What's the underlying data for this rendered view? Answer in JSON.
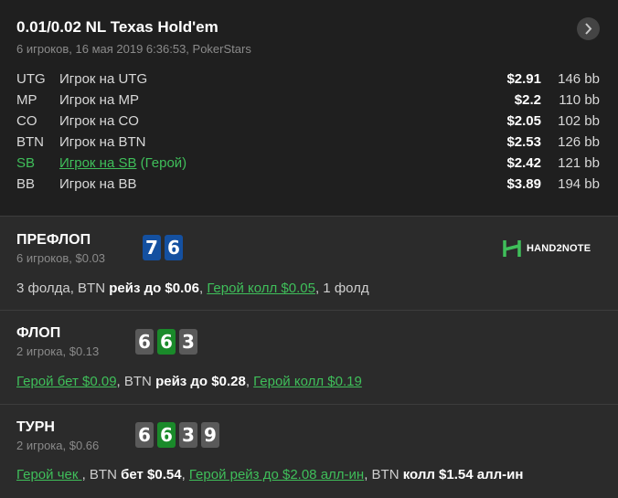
{
  "header": {
    "title": "0.01/0.02 NL Texas Hold'em",
    "subtitle": "6 игроков, 16 мая 2019 6:36:53, PokerStars",
    "next_icon": "chevron-right-icon"
  },
  "players": [
    {
      "pos": "UTG",
      "name": "Игрок на UTG",
      "hero_tag": "",
      "stack": "$2.91",
      "bb": "146 bb"
    },
    {
      "pos": "MP",
      "name": "Игрок на MP",
      "hero_tag": "",
      "stack": "$2.2",
      "bb": "110 bb"
    },
    {
      "pos": "CO",
      "name": "Игрок на CO",
      "hero_tag": "",
      "stack": "$2.05",
      "bb": "102 bb"
    },
    {
      "pos": "BTN",
      "name": "Игрок на BTN",
      "hero_tag": "",
      "stack": "$2.53",
      "bb": "126 bb"
    },
    {
      "pos": "SB",
      "name": "Игрок на SB",
      "hero_tag": " (Герой)",
      "stack": "$2.42",
      "bb": "121 bb"
    },
    {
      "pos": "BB",
      "name": "Игрок на BB",
      "hero_tag": "",
      "stack": "$3.89",
      "bb": "194 bb"
    }
  ],
  "preflop": {
    "name": "ПРЕФЛОП",
    "info": "6 игроков, $0.03",
    "cards": [
      "7",
      "6"
    ],
    "logo_text": "HAND2NOTE",
    "actions": {
      "a1": "3 фолда, BTN ",
      "a2": "рейз до $0.06",
      "a3": ", ",
      "a4": "Герой колл $0.05",
      "a5": ", 1 фолд"
    }
  },
  "flop": {
    "name": "ФЛОП",
    "info": "2 игрока, $0.13",
    "cards": [
      "6",
      "6",
      "3"
    ],
    "actions": {
      "a1": "Герой бет $0.09",
      "a2": ", BTN ",
      "a3": "рейз до $0.28",
      "a4": ", ",
      "a5": "Герой колл $0.19"
    }
  },
  "turn": {
    "name": "ТУРН",
    "info": "2 игрока, $0.66",
    "cards": [
      "6",
      "6",
      "3",
      "9"
    ],
    "actions": {
      "a1": "Герой чек ",
      "a2": ", BTN ",
      "a3": "бет $0.54",
      "a4": ", ",
      "a5": "Герой рейз до $2.08 алл-ин",
      "a6": ", BTN ",
      "a7": "колл $1.54 алл-ин"
    }
  },
  "colors": {
    "hero": "#3fbf5a",
    "card_blue": "#1450a0",
    "card_gray": "#5a5a5a",
    "card_green": "#1a8a2a"
  }
}
